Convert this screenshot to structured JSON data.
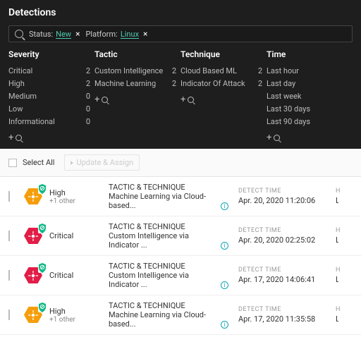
{
  "page": {
    "title": "Detections"
  },
  "filters": {
    "chips": [
      {
        "key": "Status:",
        "value": "New"
      },
      {
        "key": "Platform:",
        "value": "Linux"
      }
    ]
  },
  "facets": [
    {
      "name": "Severity",
      "items": [
        {
          "label": "Critical",
          "count": 2
        },
        {
          "label": "High",
          "count": 2
        },
        {
          "label": "Medium",
          "count": 0
        },
        {
          "label": "Low",
          "count": 0
        },
        {
          "label": "Informational",
          "count": 0
        }
      ]
    },
    {
      "name": "Tactic",
      "items": [
        {
          "label": "Custom Intelligence",
          "count": 2
        },
        {
          "label": "Machine Learning",
          "count": 2
        }
      ]
    },
    {
      "name": "Technique",
      "items": [
        {
          "label": "Cloud Based ML",
          "count": 2
        },
        {
          "label": "Indicator Of Attack",
          "count": 2
        }
      ]
    },
    {
      "name": "Time",
      "items": [
        {
          "label": "Last hour",
          "count": ""
        },
        {
          "label": "Last day",
          "count": ""
        },
        {
          "label": "Last week",
          "count": ""
        },
        {
          "label": "Last 30 days",
          "count": ""
        },
        {
          "label": "Last 90 days",
          "count": ""
        }
      ]
    }
  ],
  "toolbar": {
    "select_all": "Select All",
    "update_assign": "Update & Assign"
  },
  "column_labels": {
    "tactic_technique": "TACTIC & TECHNIQUE",
    "detect_time": "DETECT TIME",
    "host": "H"
  },
  "host_truncated": "L",
  "detections": [
    {
      "severity": "High",
      "extra": "+1 other",
      "tt": "Machine Learning via Cloud-based...",
      "time": "Apr. 20, 2020 11:20:06"
    },
    {
      "severity": "Critical",
      "extra": "",
      "tt": "Custom Intelligence via Indicator ...",
      "time": "Apr. 20, 2020 02:25:02"
    },
    {
      "severity": "Critical",
      "extra": "",
      "tt": "Custom Intelligence via Indicator ...",
      "time": "Apr. 17, 2020 14:06:41"
    },
    {
      "severity": "High",
      "extra": "+1 other",
      "tt": "Machine Learning via Cloud-based...",
      "time": "Apr. 17, 2020 11:35:58"
    }
  ]
}
